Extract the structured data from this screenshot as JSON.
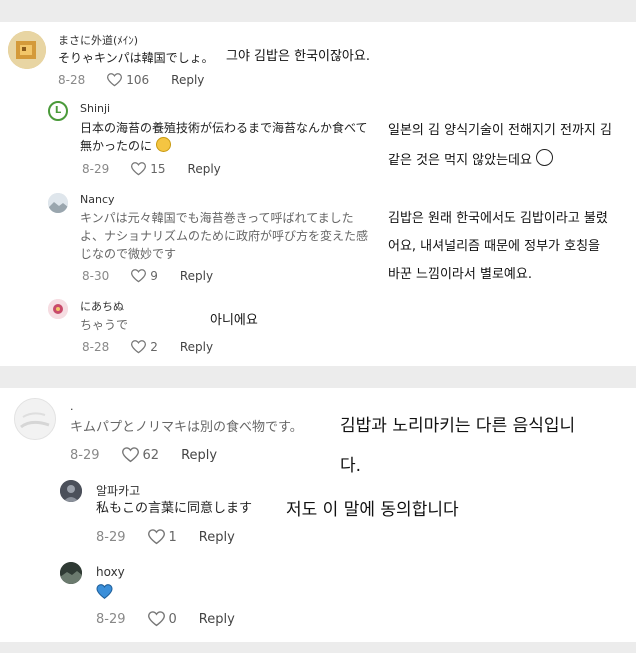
{
  "comments": [
    {
      "user": "まさに外道(ﾒｲﾝ)",
      "text": "そりゃキンパは韓国でしょ。",
      "translation": [
        "그야 김밥은 한국이잖아요."
      ],
      "date": "8-28",
      "likes": "106",
      "reply": "Reply",
      "avatar_icon": "pixel-art-avatar-icon"
    },
    {
      "user": "Shinji",
      "text_lines": [
        "日本の海苔の養殖技術が伝わるまで海苔なんか食べて",
        "無かったのに"
      ],
      "translation": [
        "일본의 김 양식기술이 전해지기 전까지 김",
        "같은 것은 먹지 않았는데요"
      ],
      "date": "8-29",
      "likes": "15",
      "reply": "Reply",
      "avatar_letter": "L",
      "avatar_color": "#4a9a3a"
    },
    {
      "user": "Nancy",
      "text_lines": [
        "キンパは元々韓国でも海苔巻きって呼ばれてました",
        "よ、ナショナリズムのために政府が呼び方を変えた感",
        "じなので微妙です"
      ],
      "translation": [
        "김밥은 원래 한국에서도 김밥이라고 불렸",
        "어요, 내셔널리즘 때문에 정부가 호칭을",
        "바꾼 느낌이라서 별로예요."
      ],
      "date": "8-30",
      "likes": "9",
      "reply": "Reply",
      "avatar_icon": "landscape-avatar-icon"
    },
    {
      "user": "にあちぬ",
      "text": "ちゃうで",
      "translation": [
        "아니에요"
      ],
      "date": "8-28",
      "likes": "2",
      "reply": "Reply",
      "avatar_icon": "flower-avatar-icon",
      "avatar_color": "#c84a6a"
    },
    {
      "user": ".",
      "text": "キムパプとノリマキは別の食べ物です。",
      "translation": [
        "김밥과 노리마키는 다른 음식입니",
        "다."
      ],
      "date": "8-29",
      "likes": "62",
      "reply": "Reply",
      "avatar_icon": "blurred-avatar-icon"
    },
    {
      "user": "알파카고",
      "text": "私もこの言葉に同意します",
      "translation": [
        "저도 이 말에 동의합니다"
      ],
      "date": "8-29",
      "likes": "1",
      "reply": "Reply",
      "avatar_icon": "dark-avatar-icon"
    },
    {
      "user": "hoxy",
      "text": "",
      "translation": [],
      "date": "8-29",
      "likes": "0",
      "reply": "Reply",
      "avatar_icon": "landscape-avatar-icon",
      "content_icon": "blue-heart-icon",
      "heart_color": "#3b8fd9"
    }
  ],
  "colors": {
    "background": "#ececec",
    "panel": "#ffffff",
    "meta": "#888888"
  }
}
